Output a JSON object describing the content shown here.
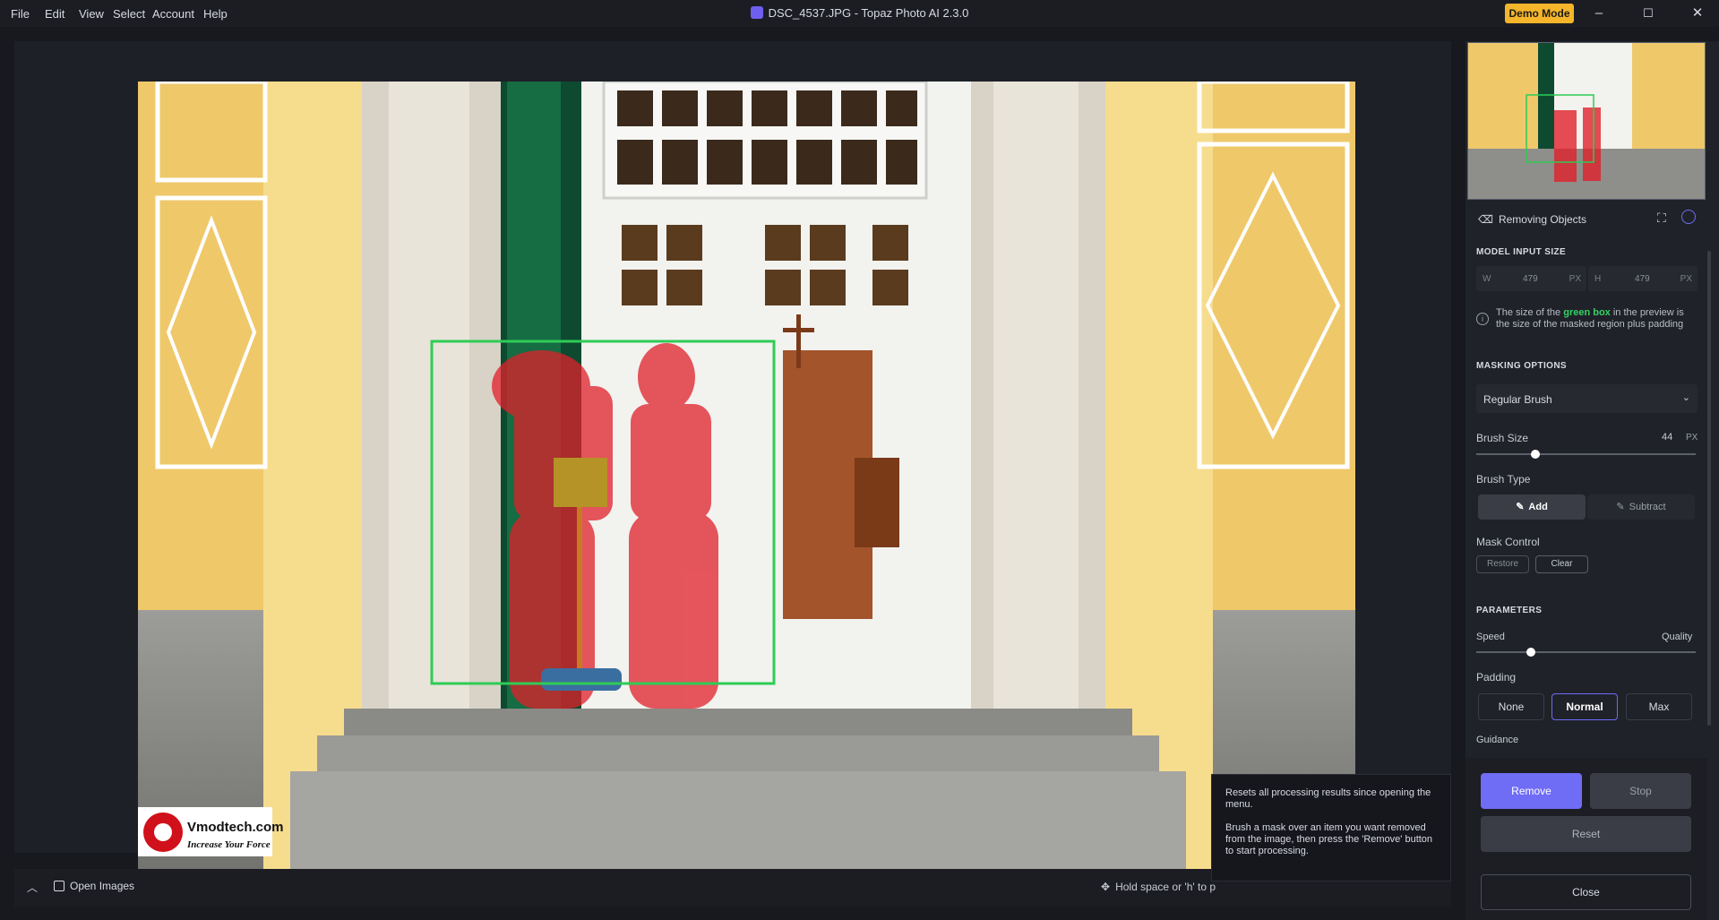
{
  "menu": [
    "File",
    "Edit",
    "View",
    "Select",
    "Account",
    "Help"
  ],
  "window": {
    "title": "DSC_4537.JPG - Topaz Photo AI 2.3.0",
    "demo_label": "Demo Mode"
  },
  "controls": {
    "minimize": "–",
    "maximize": "☐",
    "close": "✕"
  },
  "sidebar": {
    "tool_title": "Removing Objects",
    "model_input_size": {
      "heading": "MODEL INPUT SIZE",
      "w_label": "W",
      "w_value": "479",
      "w_unit": "PX",
      "h_label": "H",
      "h_value": "479",
      "h_unit": "PX"
    },
    "info": {
      "pre": "The size of the ",
      "highlight": "green box",
      "post": " in the preview is the size of the masked region plus padding"
    },
    "masking": {
      "heading": "MASKING OPTIONS",
      "brush_select": "Regular Brush",
      "brush_size_label": "Brush Size",
      "brush_size_value": "44",
      "brush_size_unit": "PX",
      "brush_size_level": 0.27,
      "brush_type_label": "Brush Type",
      "add_label": "Add",
      "subtract_label": "Subtract",
      "mask_control_label": "Mask Control",
      "restore_label": "Restore",
      "clear_label": "Clear"
    },
    "parameters": {
      "heading": "PARAMETERS",
      "speed_label": "Speed",
      "quality_label": "Quality",
      "speed_quality_level": 0.25,
      "padding_label": "Padding",
      "padding_options": [
        "None",
        "Normal",
        "Max"
      ],
      "padding_selected": "Normal",
      "guidance_label": "Guidance"
    },
    "actions": {
      "remove": "Remove",
      "stop": "Stop",
      "reset": "Reset",
      "close": "Close"
    }
  },
  "tooltip": {
    "line1": "Resets all processing results since opening the menu.",
    "line2": "Brush a mask over an item you want removed from the image, then press the 'Remove' button to start processing."
  },
  "bottom": {
    "open_images": "Open Images",
    "hint": "Hold space or 'h' to p"
  },
  "watermark": {
    "brand": "Vmodtech.com",
    "tagline": "Increase Your Force"
  },
  "colors": {
    "accent": "#6f6cf5",
    "mask": "#e0202a",
    "box": "#2ecc55",
    "demo": "#f5b52a",
    "green_text": "#34d266"
  }
}
